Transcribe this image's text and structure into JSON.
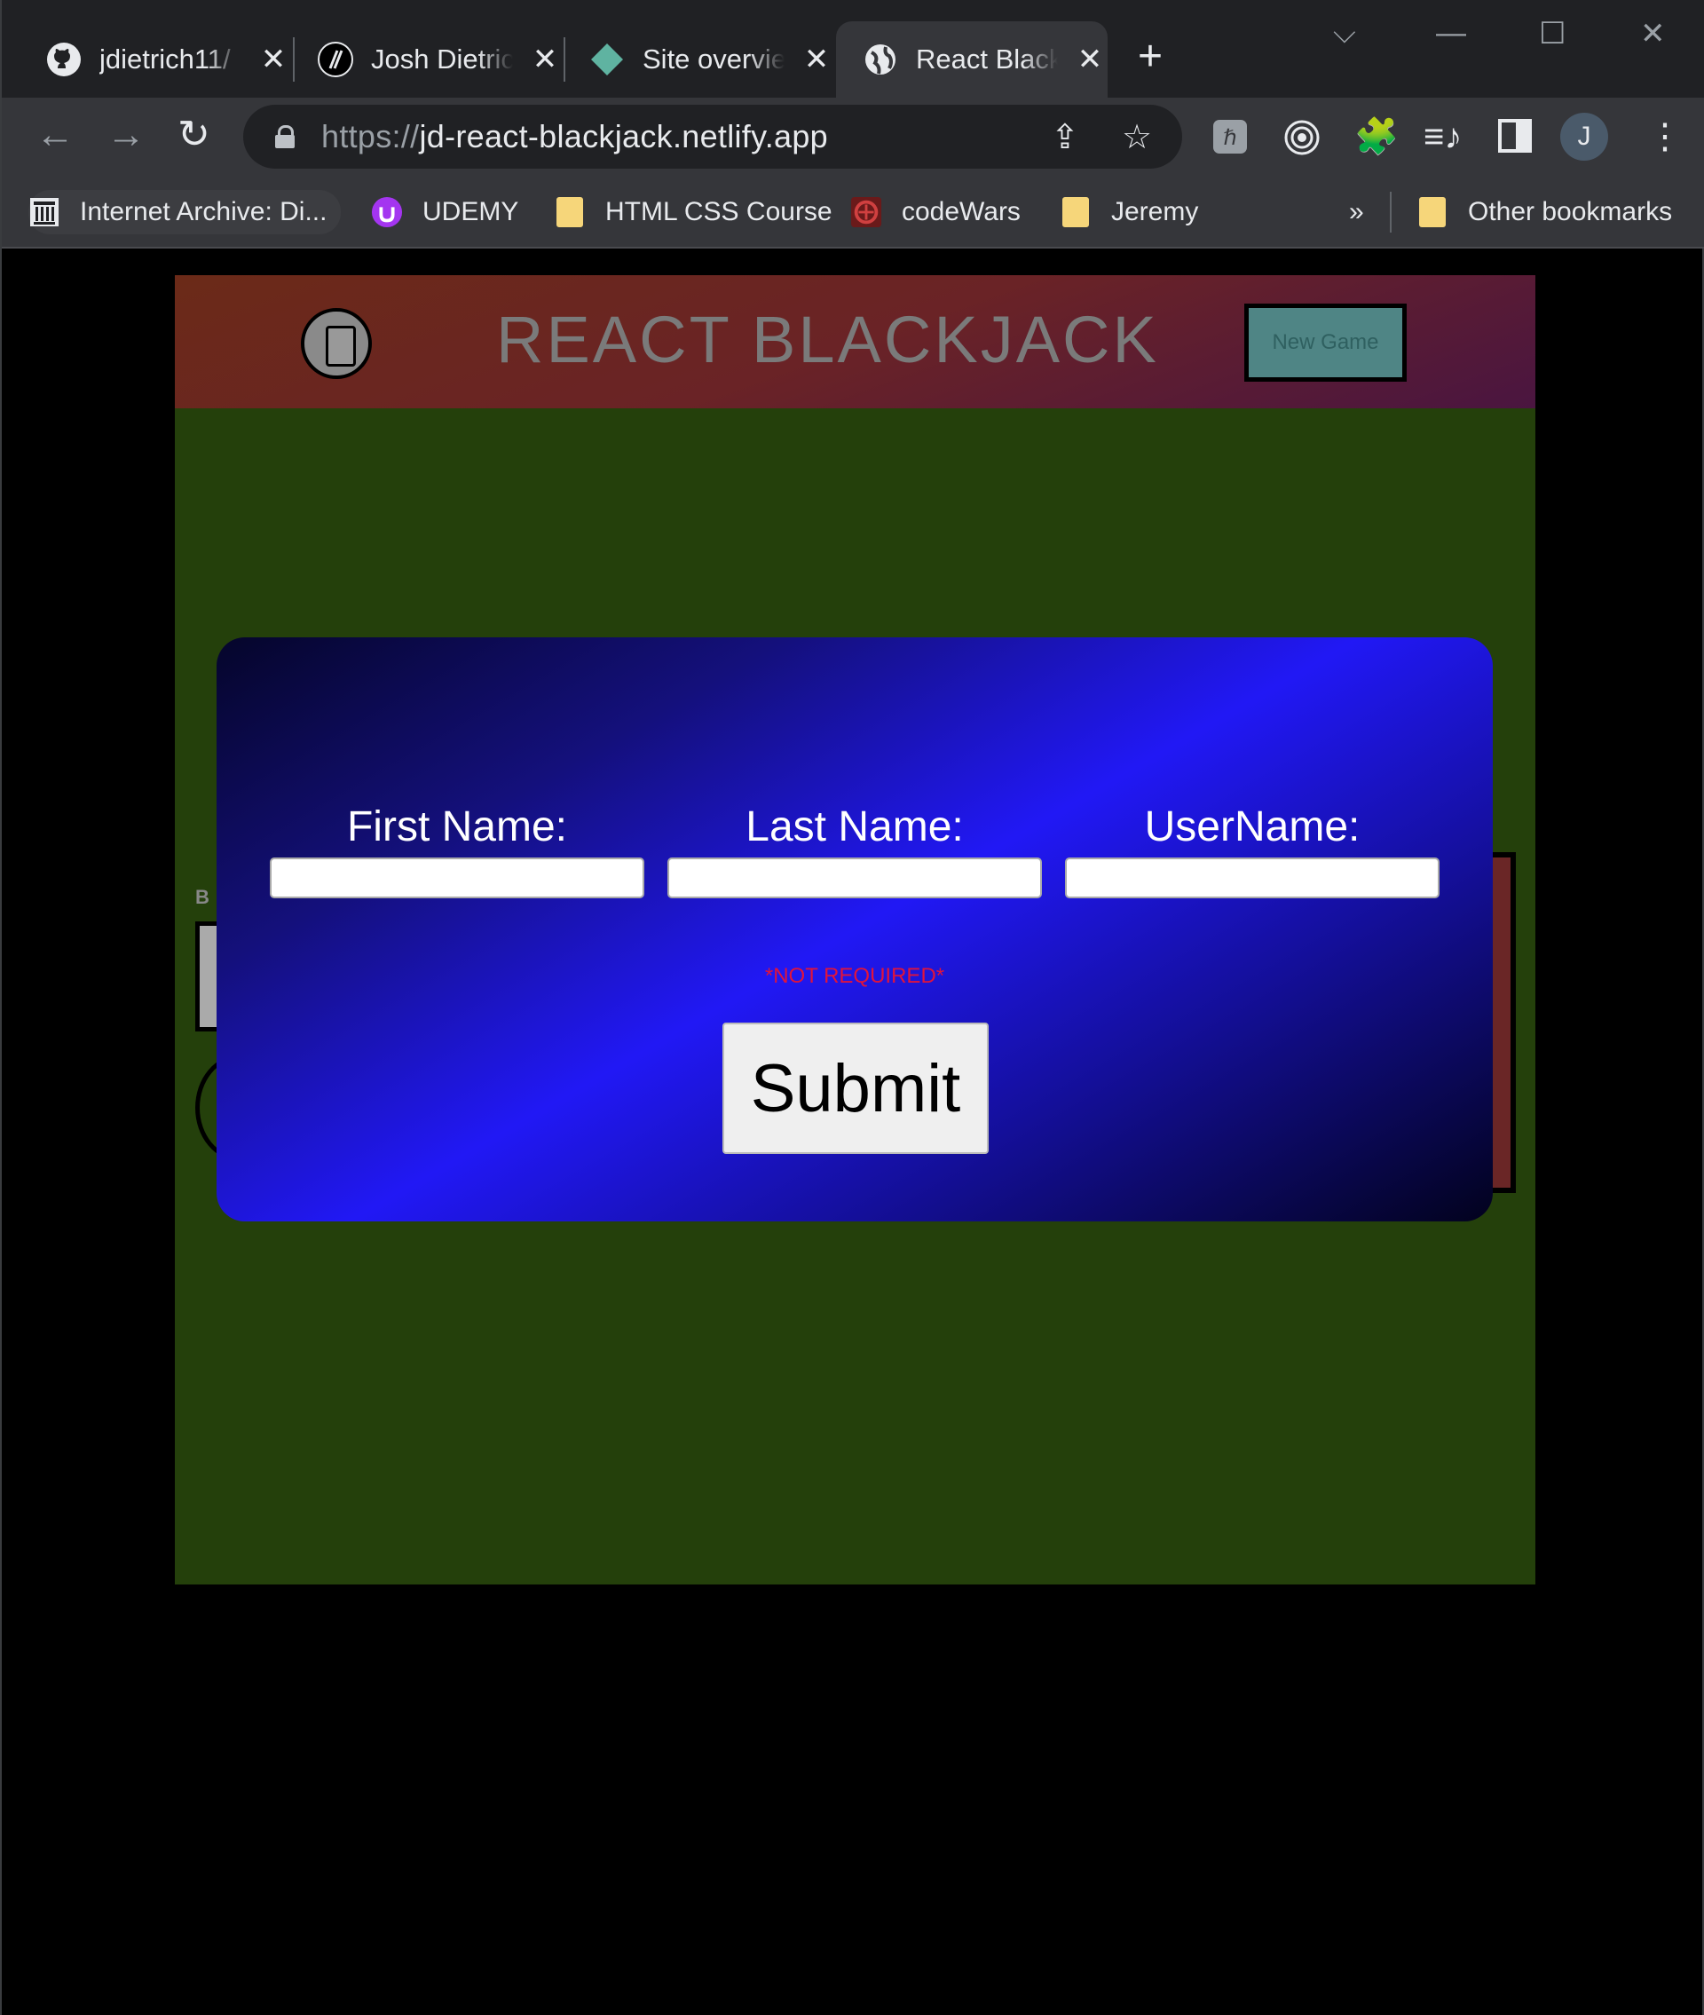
{
  "browser": {
    "tabs": [
      {
        "title": "jdietrich11/",
        "icon": "github-icon"
      },
      {
        "title": "Josh Dietrich",
        "icon": "jd-logo-icon"
      },
      {
        "title": "Site overview",
        "icon": "netlify-icon"
      },
      {
        "title": "React Blackjack",
        "icon": "globe-icon",
        "active": true
      }
    ],
    "url_scheme": "https://",
    "url_host": "jd-react-blackjack.netlify.app",
    "profile_initial": "J",
    "bookmarks": [
      {
        "label": "Internet Archive: Di...",
        "icon": "archive-icon"
      },
      {
        "label": "UDEMY",
        "icon": "udemy-icon"
      },
      {
        "label": "HTML CSS Course",
        "icon": "folder-icon"
      },
      {
        "label": "codeWars",
        "icon": "codewars-icon"
      },
      {
        "label": "Jeremy",
        "icon": "folder-icon"
      }
    ],
    "overflow": "»",
    "other_bookmarks": "Other bookmarks"
  },
  "app": {
    "title": "REACT BLACKJACK",
    "new_game": "New Game",
    "remnant_label": "B"
  },
  "modal": {
    "first_name_label": "First Name:",
    "last_name_label": "Last Name:",
    "username_label": "UserName:",
    "note": "*NOT REQUIRED*",
    "submit": "Submit"
  },
  "colors": {
    "table_green": "#24400b",
    "modal_blue": "#2118f5",
    "note_red": "#e0143c",
    "new_game_teal": "#4f8585"
  }
}
